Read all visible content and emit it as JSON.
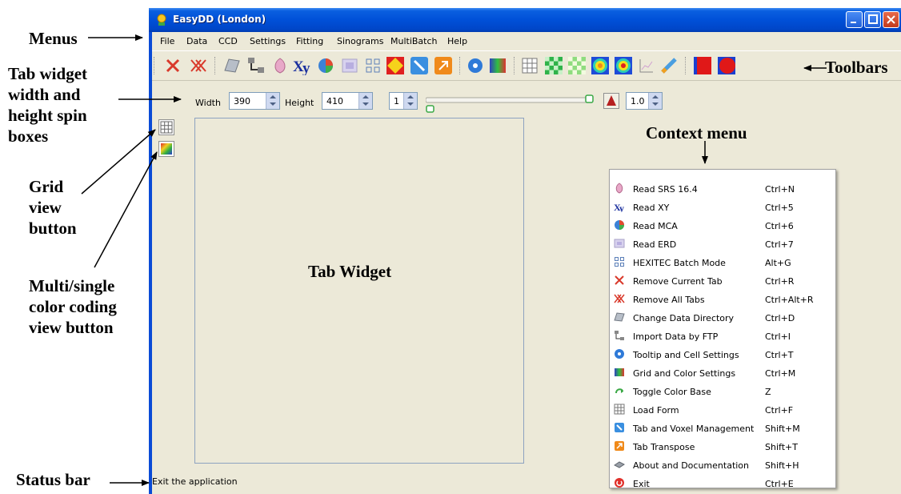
{
  "annotations": {
    "menus": "Menus",
    "toolbars": "Toolbars",
    "tab_size": [
      "Tab widget",
      "width and",
      "height spin",
      "boxes"
    ],
    "context_menu": "Context menu",
    "grid_view": [
      "Grid",
      "view",
      "button"
    ],
    "multi_color": [
      "Multi/single",
      "color coding",
      "view button"
    ],
    "status_bar": "Status bar"
  },
  "window": {
    "title": "EasyDD (London)"
  },
  "menubar": [
    "File",
    "Data",
    "CCD",
    "Settings",
    "Fitting",
    "Sinograms",
    "MultiBatch",
    "Help"
  ],
  "controls": {
    "width_label": "Width",
    "width_value": "390",
    "height_label": "Height",
    "height_value": "410",
    "index_value": "1",
    "scale_value": "1.0"
  },
  "tab_widget_label": "Tab Widget",
  "context_menu": [
    {
      "label": "Read SRS 16.4",
      "shortcut": "Ctrl+N",
      "icon": "srs-icon"
    },
    {
      "label": "Read XY",
      "shortcut": "Ctrl+5",
      "icon": "xy-icon"
    },
    {
      "label": "Read MCA",
      "shortcut": "Ctrl+6",
      "icon": "mca-icon"
    },
    {
      "label": "Read ERD",
      "shortcut": "Ctrl+7",
      "icon": "erd-icon"
    },
    {
      "label": "HEXITEC Batch Mode",
      "shortcut": "Alt+G",
      "icon": "hexitec-icon"
    },
    {
      "label": "Remove Current Tab",
      "shortcut": "Ctrl+R",
      "icon": "remove-tab-icon"
    },
    {
      "label": "Remove All Tabs",
      "shortcut": "Ctrl+Alt+R",
      "icon": "remove-all-icon"
    },
    {
      "label": "Change Data Directory",
      "shortcut": "Ctrl+D",
      "icon": "directory-icon"
    },
    {
      "label": "Import Data by FTP",
      "shortcut": "Ctrl+I",
      "icon": "ftp-icon"
    },
    {
      "label": "Tooltip and Cell Settings",
      "shortcut": "Ctrl+T",
      "icon": "tooltip-icon"
    },
    {
      "label": "Grid and Color Settings",
      "shortcut": "Ctrl+M",
      "icon": "grid-color-icon"
    },
    {
      "label": "Toggle Color Base",
      "shortcut": "Z",
      "icon": "color-base-icon"
    },
    {
      "label": "Load Form",
      "shortcut": "Ctrl+F",
      "icon": "load-form-icon"
    },
    {
      "label": "Tab and Voxel Management",
      "shortcut": "Shift+M",
      "icon": "voxel-icon"
    },
    {
      "label": "Tab Transpose",
      "shortcut": "Shift+T",
      "icon": "transpose-icon"
    },
    {
      "label": "About and Documentation",
      "shortcut": "Shift+H",
      "icon": "about-icon"
    },
    {
      "label": "Exit",
      "shortcut": "Ctrl+E",
      "icon": "exit-icon"
    }
  ],
  "status_text": "Exit the application"
}
